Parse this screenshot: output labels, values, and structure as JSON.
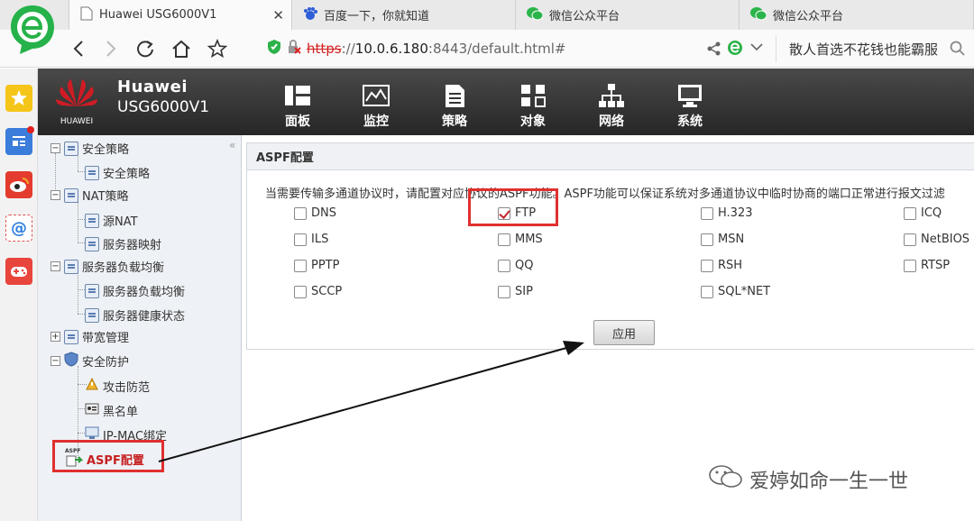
{
  "browser": {
    "tabs": [
      {
        "label": "Huawei USG6000V1",
        "active": true
      },
      {
        "label": "百度一下，你就知道",
        "active": false
      },
      {
        "label": "微信公众平台",
        "active": false
      },
      {
        "label": "微信公众平台",
        "active": false
      }
    ],
    "close_glyph": "✕",
    "url": {
      "scheme": "https",
      "sep": "://",
      "host": "10.0.6.180",
      "rest": ":8443/default.html#"
    },
    "search_text": "散人首选不花钱也能霸服"
  },
  "header": {
    "logo_text": "HUAWEI",
    "brand_line1": "Huawei",
    "brand_line2": "USG6000V1",
    "menu": [
      {
        "label": "面板",
        "icon": "dashboard-icon"
      },
      {
        "label": "监控",
        "icon": "monitor-chart-icon"
      },
      {
        "label": "策略",
        "icon": "policy-doc-icon"
      },
      {
        "label": "对象",
        "icon": "objects-icon"
      },
      {
        "label": "网络",
        "icon": "network-icon"
      },
      {
        "label": "系统",
        "icon": "system-icon"
      }
    ]
  },
  "tree": {
    "collapse_glyph": "«",
    "items": [
      {
        "label": "安全策略"
      },
      {
        "label": "安全策略"
      },
      {
        "label": "NAT策略"
      },
      {
        "label": "源NAT"
      },
      {
        "label": "服务器映射"
      },
      {
        "label": "服务器负载均衡"
      },
      {
        "label": "服务器负载均衡"
      },
      {
        "label": "服务器健康状态"
      },
      {
        "label": "带宽管理"
      },
      {
        "label": "安全防护"
      },
      {
        "label": "攻击防范"
      },
      {
        "label": "黑名单"
      },
      {
        "label": "IP-MAC绑定"
      },
      {
        "label": "ASPF配置"
      }
    ],
    "aspf_icon_text": "ASPF"
  },
  "content": {
    "panel_title": "ASPF配置",
    "description": "当需要传输多通道协议时，请配置对应协议的ASPF功能。ASPF功能可以保证系统对多通道协议中临时协商的端口正常进行报文过滤",
    "protocols": [
      {
        "label": "DNS",
        "checked": false
      },
      {
        "label": "FTP",
        "checked": true
      },
      {
        "label": "H.323",
        "checked": false
      },
      {
        "label": "ICQ",
        "checked": false
      },
      {
        "label": "ILS",
        "checked": false
      },
      {
        "label": "MMS",
        "checked": false
      },
      {
        "label": "MSN",
        "checked": false
      },
      {
        "label": "NetBIOS",
        "checked": false
      },
      {
        "label": "PPTP",
        "checked": false
      },
      {
        "label": "QQ",
        "checked": false
      },
      {
        "label": "RSH",
        "checked": false
      },
      {
        "label": "RTSP",
        "checked": false
      },
      {
        "label": "SCCP",
        "checked": false
      },
      {
        "label": "SIP",
        "checked": false
      },
      {
        "label": "SQL*NET",
        "checked": false
      }
    ],
    "apply_label": "应用"
  },
  "watermark": "爱婷如命一生一世",
  "colors": {
    "highlight": "#e03030",
    "header_bg": "#2f2f2f",
    "tree_bg": "#eef1f5"
  }
}
